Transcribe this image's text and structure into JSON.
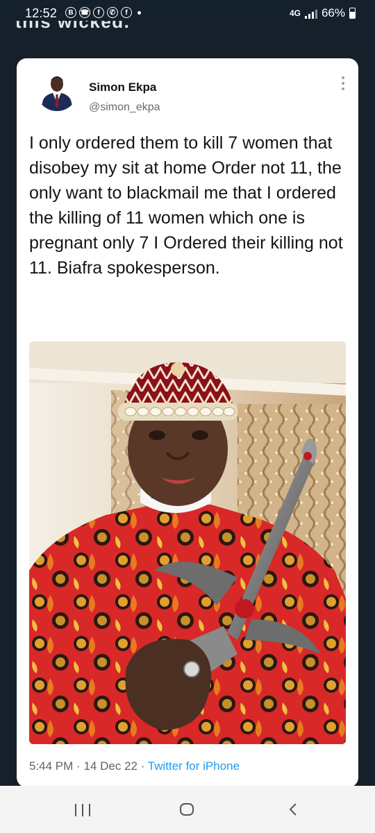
{
  "status_bar": {
    "time": "12:52",
    "network": "4G",
    "battery": "66%",
    "notification_icons": [
      "B",
      "☎",
      "f",
      "✆",
      "f"
    ]
  },
  "background_text": "this wicked.",
  "tweet": {
    "author_name": "Simon Ekpa",
    "author_handle": "@simon_ekpa",
    "text": "I only ordered them to kill 7 women that disobey my sit at home Order not 11, the only want to blackmail me that I ordered the killing of 11 women which one is pregnant only 7 I Ordered their killing not 11. Biafra spokesperson.",
    "time": "5:44 PM",
    "date": "14 Dec 22",
    "source": "Twitter for iPhone",
    "separator": "·"
  },
  "colors": {
    "background": "#15202b",
    "card": "#ffffff",
    "link": "#1d9bf0"
  }
}
